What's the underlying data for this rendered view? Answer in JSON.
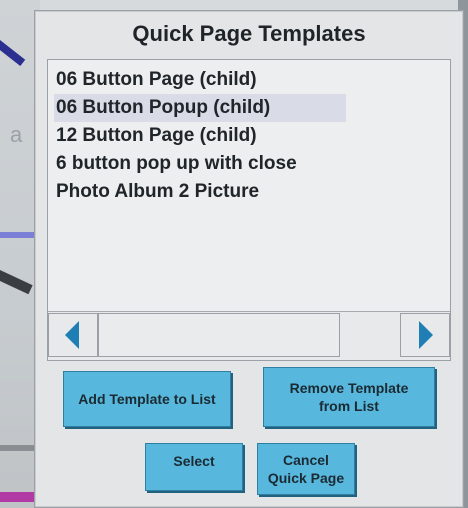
{
  "dialog": {
    "title": "Quick Page Templates"
  },
  "template_list": {
    "items": [
      {
        "label": "06 Button Page (child)",
        "selected": false
      },
      {
        "label": "06 Button Popup (child)",
        "selected": true
      },
      {
        "label": "12 Button Page (child)",
        "selected": false
      },
      {
        "label": "6 button pop up with close",
        "selected": false
      },
      {
        "label": "Photo Album 2 Picture",
        "selected": false
      }
    ]
  },
  "buttons": {
    "add_label": "Add Template to List",
    "remove_label": "Remove Template\nfrom List",
    "select_label": "Select",
    "cancel_label": "Cancel\nQuick Page"
  },
  "icons": {
    "scroll_left": "chevron-left-icon",
    "scroll_right": "chevron-right-icon"
  },
  "colors": {
    "button": "#57b7dc",
    "scroll_arrow": "#1f7fb4",
    "selection": "#d9dce6"
  },
  "background_app": {
    "partial_letter": "a"
  }
}
